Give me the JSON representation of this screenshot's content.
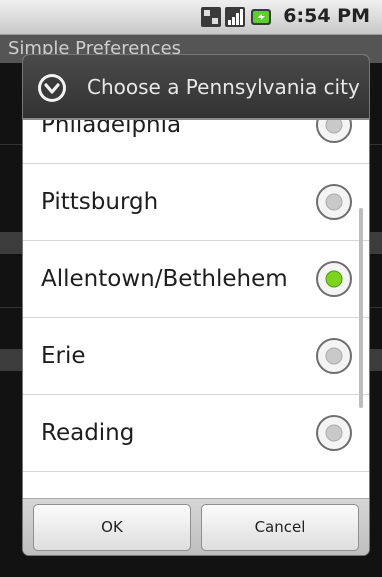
{
  "status_bar": {
    "time": "6:54 PM",
    "icons": [
      "usb-debug-icon",
      "signal-icon",
      "battery-charging-icon"
    ]
  },
  "background_app": {
    "title": "Simple Preferences"
  },
  "dialog": {
    "title": "Choose a Pennsylvania city",
    "title_icon": "chevron-down-circle-icon",
    "items": [
      {
        "label": "Philadelphia",
        "selected": false
      },
      {
        "label": "Pittsburgh",
        "selected": false
      },
      {
        "label": "Allentown/Bethlehem",
        "selected": true
      },
      {
        "label": "Erie",
        "selected": false
      },
      {
        "label": "Reading",
        "selected": false
      }
    ],
    "ok_label": "OK",
    "cancel_label": "Cancel"
  },
  "colors": {
    "radio_selected": "#7ed321",
    "dialog_title_bg": "#3c3c3c"
  }
}
